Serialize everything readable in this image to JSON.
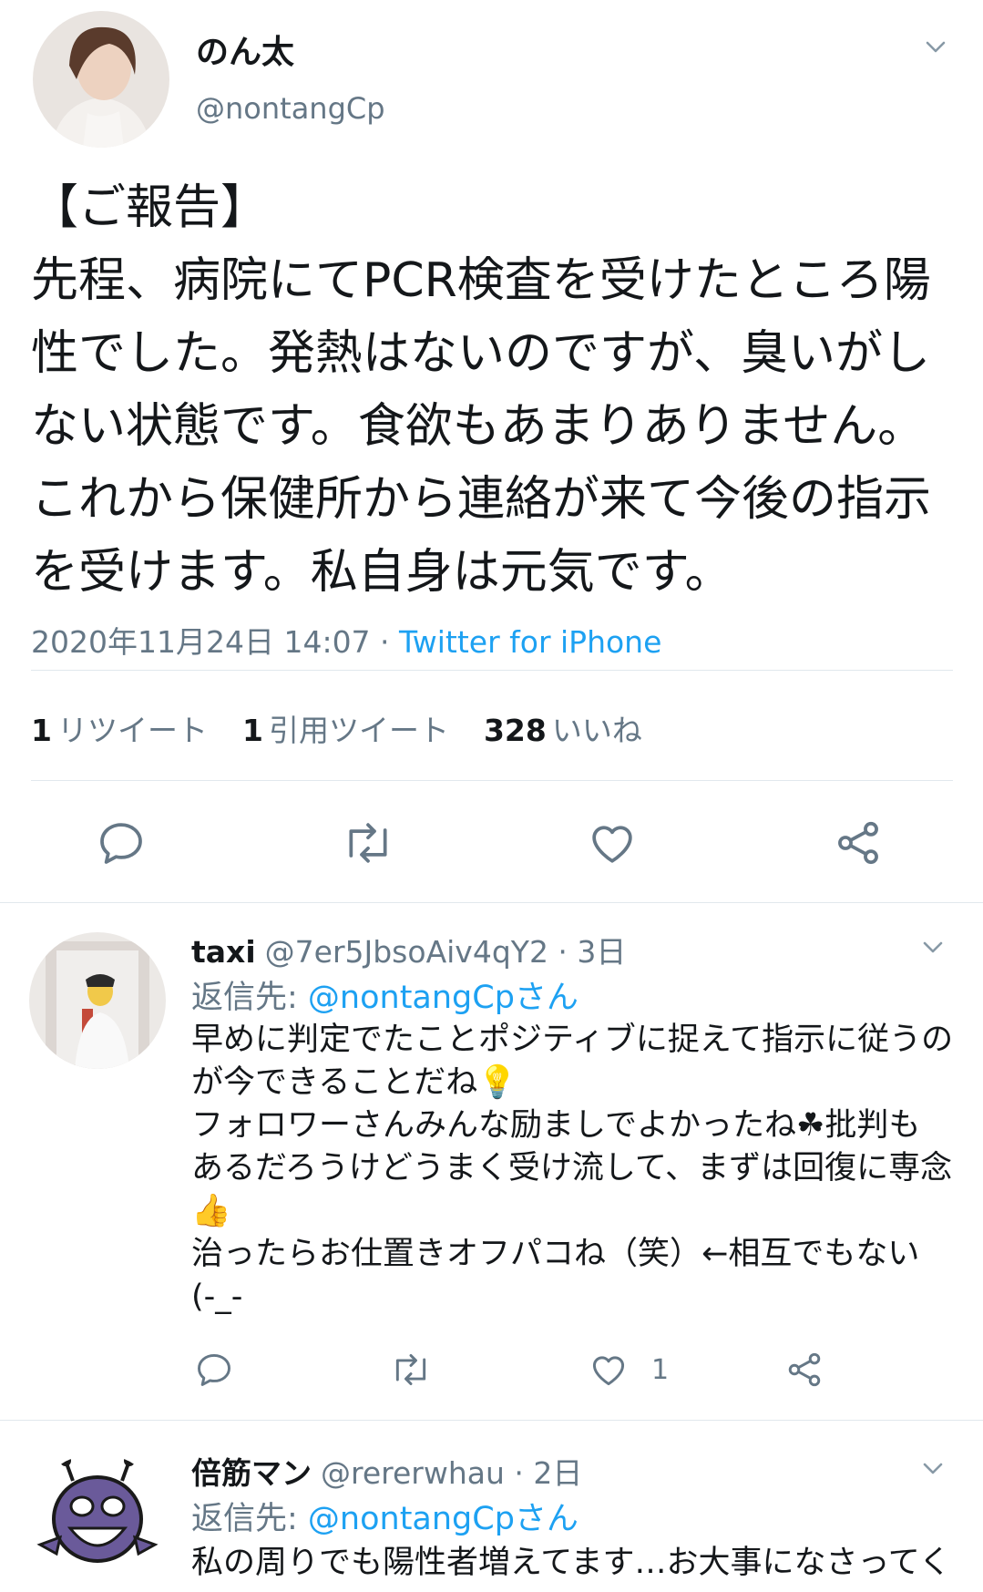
{
  "main_tweet": {
    "name": "のん太",
    "handle": "@nontangCp",
    "body_lines": [
      "【ご報告】",
      "先程、病院にてPCR検査を受けたところ陽",
      "性でした。発熱はないのですが、臭いがし",
      "ない状態です。食欲もあまりありません。",
      "これから保健所から連絡が来て今後の指示",
      "を受けます。私自身は元気です。"
    ],
    "timestamp": "2020年11月24日 14:07",
    "separator": " · ",
    "source": "Twitter for iPhone",
    "stats": {
      "retweets_count": "1",
      "retweets_label": "リツイート",
      "quotes_count": "1",
      "quotes_label": "引用ツイート",
      "likes_count": "328",
      "likes_label": "いいね"
    }
  },
  "replies": [
    {
      "name": "taxi",
      "handle": "@7er5JbsoAiv4qY2 · 3日",
      "reply_prefix": "返信先: ",
      "reply_to": "@nontangCpさん",
      "text_lines": [
        "早めに判定でたことポジティブに捉えて指示に従うの",
        "が今できることだね💡",
        "フォロワーさんみんな励ましでよかったね☘批判も",
        "あるだろうけどうまく受け流して、まずは回復に専念",
        "👍",
        "治ったらお仕置きオフパコね（笑）←相互でもない",
        "(-_-"
      ],
      "like_count": "1"
    },
    {
      "name": "倍筋マン",
      "handle": "@rererwhau · 2日",
      "reply_prefix": "返信先: ",
      "reply_to": "@nontangCpさん",
      "text_lines": [
        "私の周りでも陽性者増えてます…お大事になさってく"
      ]
    }
  ],
  "colors": {
    "accent": "#1da1f2",
    "secondary_text": "#657786",
    "divider": "#e1e8ed",
    "icon": "#657786"
  }
}
